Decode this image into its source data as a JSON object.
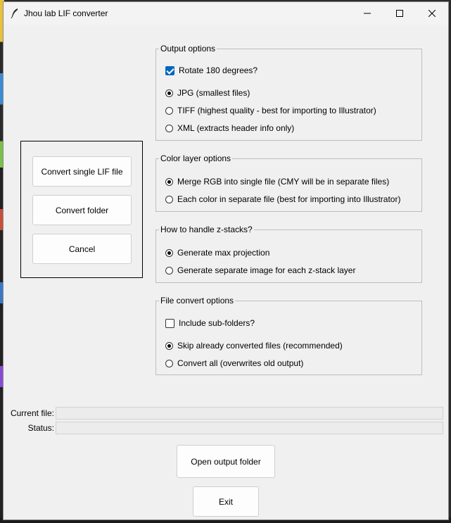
{
  "window": {
    "title": "Jhou lab LIF converter",
    "icon": "feather-icon"
  },
  "actions": {
    "convert_single": "Convert single LIF file",
    "convert_folder": "Convert folder",
    "cancel": "Cancel"
  },
  "output_options": {
    "legend": "Output options",
    "rotate": {
      "label": "Rotate 180 degrees?",
      "checked": true
    },
    "formats": [
      {
        "label": "JPG (smallest files)",
        "selected": true
      },
      {
        "label": "TIFF (highest quality - best for importing to Illustrator)",
        "selected": false
      },
      {
        "label": "XML (extracts header info only)",
        "selected": false
      }
    ]
  },
  "color_options": {
    "legend": "Color layer options",
    "choices": [
      {
        "label": "Merge RGB into single file (CMY will be in separate files)",
        "selected": true
      },
      {
        "label": "Each color in separate file (best for importing into Illustrator)",
        "selected": false
      }
    ]
  },
  "zstack_options": {
    "legend": "How to handle z-stacks?",
    "choices": [
      {
        "label": "Generate max projection",
        "selected": true
      },
      {
        "label": "Generate separate image for each z-stack layer",
        "selected": false
      }
    ]
  },
  "file_options": {
    "legend": "File convert options",
    "subfolders": {
      "label": "Include sub-folders?",
      "checked": false
    },
    "choices": [
      {
        "label": "Skip already converted files (recommended)",
        "selected": true
      },
      {
        "label": "Convert all (overwrites old output)",
        "selected": false
      }
    ]
  },
  "status": {
    "current_file_label": "Current file:",
    "current_file_value": "",
    "status_label": "Status:",
    "status_value": ""
  },
  "bottom": {
    "open_output": "Open output folder",
    "exit": "Exit"
  },
  "colors": {
    "accent": "#0067c0",
    "window_bg": "#f0f0f0"
  }
}
